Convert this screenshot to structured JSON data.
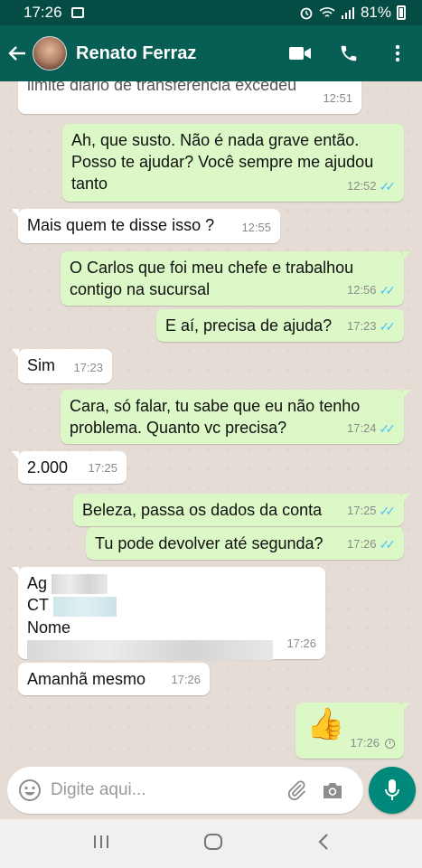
{
  "status_bar": {
    "time": "17:26",
    "battery": "81%"
  },
  "header": {
    "contact_name": "Renato Ferraz"
  },
  "messages": [
    {
      "dir": "in",
      "text": "limite diário de transferência excedeu",
      "time": "12:51"
    },
    {
      "dir": "out",
      "text": "Ah, que susto. Não é nada grave então. Posso te ajudar? Você sempre me ajudou tanto",
      "time": "12:52",
      "status": "read"
    },
    {
      "dir": "in",
      "text": "Mais quem te disse isso ?",
      "time": "12:55"
    },
    {
      "dir": "out",
      "text": "O Carlos que foi meu chefe e trabalhou contigo na sucursal",
      "time": "12:56",
      "status": "read"
    },
    {
      "dir": "out",
      "text": "E aí, precisa de ajuda?",
      "time": "17:23",
      "status": "read"
    },
    {
      "dir": "in",
      "text": "Sim",
      "time": "17:23"
    },
    {
      "dir": "out",
      "text": "Cara, só falar, tu sabe que eu não tenho problema. Quanto vc precisa?",
      "time": "17:24",
      "status": "read"
    },
    {
      "dir": "in",
      "text": "2.000",
      "time": "17:25"
    },
    {
      "dir": "out",
      "text": "Beleza, passa os dados da conta",
      "time": "17:25",
      "status": "read"
    },
    {
      "dir": "out",
      "text": "Tu pode devolver até segunda?",
      "time": "17:26",
      "status": "read"
    },
    {
      "dir": "in",
      "lines": [
        "Ag",
        "CT",
        "Nome"
      ],
      "time": "17:26"
    },
    {
      "dir": "in",
      "text": "Amanhã mesmo",
      "time": "17:26"
    },
    {
      "dir": "out",
      "emoji": "👍",
      "time": "17:26",
      "status": "pending"
    }
  ],
  "input": {
    "placeholder": "Digite aqui..."
  },
  "colors": {
    "header": "#075e54",
    "statusbar": "#054d44",
    "outgoing": "#dcf8c6",
    "incoming": "#ffffff",
    "accent": "#00897b",
    "read_ticks": "#4fc3f7"
  },
  "icons": [
    "back-arrow-icon",
    "video-call-icon",
    "phone-icon",
    "more-options-icon",
    "emoji-icon",
    "attach-icon",
    "camera-icon",
    "mic-icon"
  ]
}
